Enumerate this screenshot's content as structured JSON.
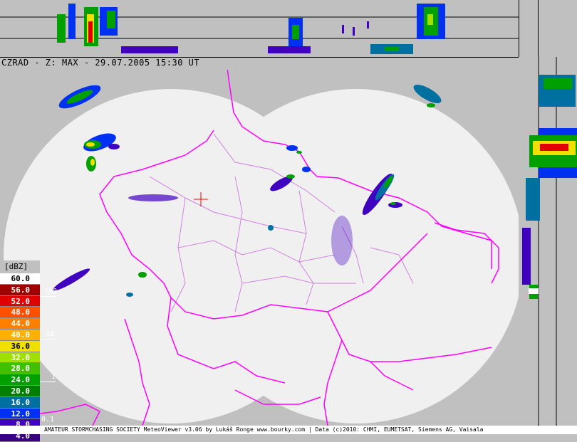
{
  "title": "CZRAD - Z: MAX - 29.07.2005 15:30 UT",
  "legend": {
    "unit": "[dBZ]",
    "levels": [
      {
        "value": "60.0",
        "color": "#ffffff",
        "text_color": "#000000"
      },
      {
        "value": "56.0",
        "color": "#a00000",
        "text_color": "#ffffff"
      },
      {
        "value": "52.0",
        "color": "#e00000",
        "text_color": "#ffffff"
      },
      {
        "value": "48.0",
        "color": "#ff5000",
        "text_color": "#ffffff"
      },
      {
        "value": "44.0",
        "color": "#ff8000",
        "text_color": "#ffffff"
      },
      {
        "value": "40.0",
        "color": "#ffb000",
        "text_color": "#ffffff"
      },
      {
        "value": "36.0",
        "color": "#f0e000",
        "text_color": "#000000"
      },
      {
        "value": "32.0",
        "color": "#a0e000",
        "text_color": "#ffffff"
      },
      {
        "value": "28.0",
        "color": "#40c000",
        "text_color": "#ffffff"
      },
      {
        "value": "24.0",
        "color": "#00a000",
        "text_color": "#ffffff"
      },
      {
        "value": "20.0",
        "color": "#008000",
        "text_color": "#ffffff"
      },
      {
        "value": "16.0",
        "color": "#0070a0",
        "text_color": "#ffffff"
      },
      {
        "value": "12.0",
        "color": "#0030f0",
        "text_color": "#ffffff"
      },
      {
        "value": "8.0",
        "color": "#4000c0",
        "text_color": "#ffffff"
      },
      {
        "value": "4.0",
        "color": "#380080",
        "text_color": "#ffffff"
      }
    ]
  },
  "rain_scale": [
    "100",
    "10",
    "1",
    "0.1"
  ],
  "footer": "AMATEUR STORMCHASING SOCIETY MeteoViewer v3.06 by Lukáš Ronge www.bourky.com | Data (c)2010: CHMI, EUMETSAT, Siemens AG, Vaisala",
  "colors": {
    "border_country": "#ff00ff",
    "border_region": "#d080e0",
    "radar_coverage": "#f0f0f0",
    "background": "#c0c0c0",
    "crosshair": "#ff0000"
  }
}
